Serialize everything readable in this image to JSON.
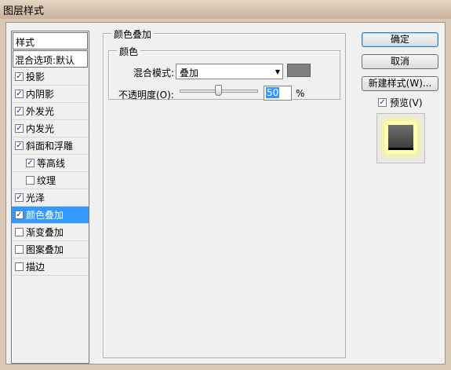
{
  "window": {
    "title": "图层样式"
  },
  "style_list": {
    "header": "样式",
    "defaults": "混合选项:默认",
    "items": [
      {
        "label": "投影",
        "checked": true,
        "indent": false,
        "selected": false
      },
      {
        "label": "内阴影",
        "checked": true,
        "indent": false,
        "selected": false
      },
      {
        "label": "外发光",
        "checked": true,
        "indent": false,
        "selected": false
      },
      {
        "label": "内发光",
        "checked": true,
        "indent": false,
        "selected": false
      },
      {
        "label": "斜面和浮雕",
        "checked": true,
        "indent": false,
        "selected": false
      },
      {
        "label": "等高线",
        "checked": true,
        "indent": true,
        "selected": false
      },
      {
        "label": "纹理",
        "checked": false,
        "indent": true,
        "selected": false
      },
      {
        "label": "光泽",
        "checked": true,
        "indent": false,
        "selected": false
      },
      {
        "label": "颜色叠加",
        "checked": true,
        "indent": false,
        "selected": true
      },
      {
        "label": "渐变叠加",
        "checked": false,
        "indent": false,
        "selected": false
      },
      {
        "label": "图案叠加",
        "checked": false,
        "indent": false,
        "selected": false
      },
      {
        "label": "描边",
        "checked": false,
        "indent": false,
        "selected": false
      }
    ]
  },
  "panel": {
    "title": "颜色叠加",
    "group_title": "颜色",
    "blend_mode_label": "混合模式:",
    "blend_mode_value": "叠加",
    "overlay_color": "#808080",
    "opacity_label": "不透明度(O):",
    "opacity_value": "50",
    "opacity_unit": "%",
    "opacity_slider_level": 0.5
  },
  "buttons": {
    "ok": "确定",
    "cancel": "取消",
    "new_style": "新建样式(W)...",
    "preview_label": "预览(V)",
    "preview_checked": true
  }
}
